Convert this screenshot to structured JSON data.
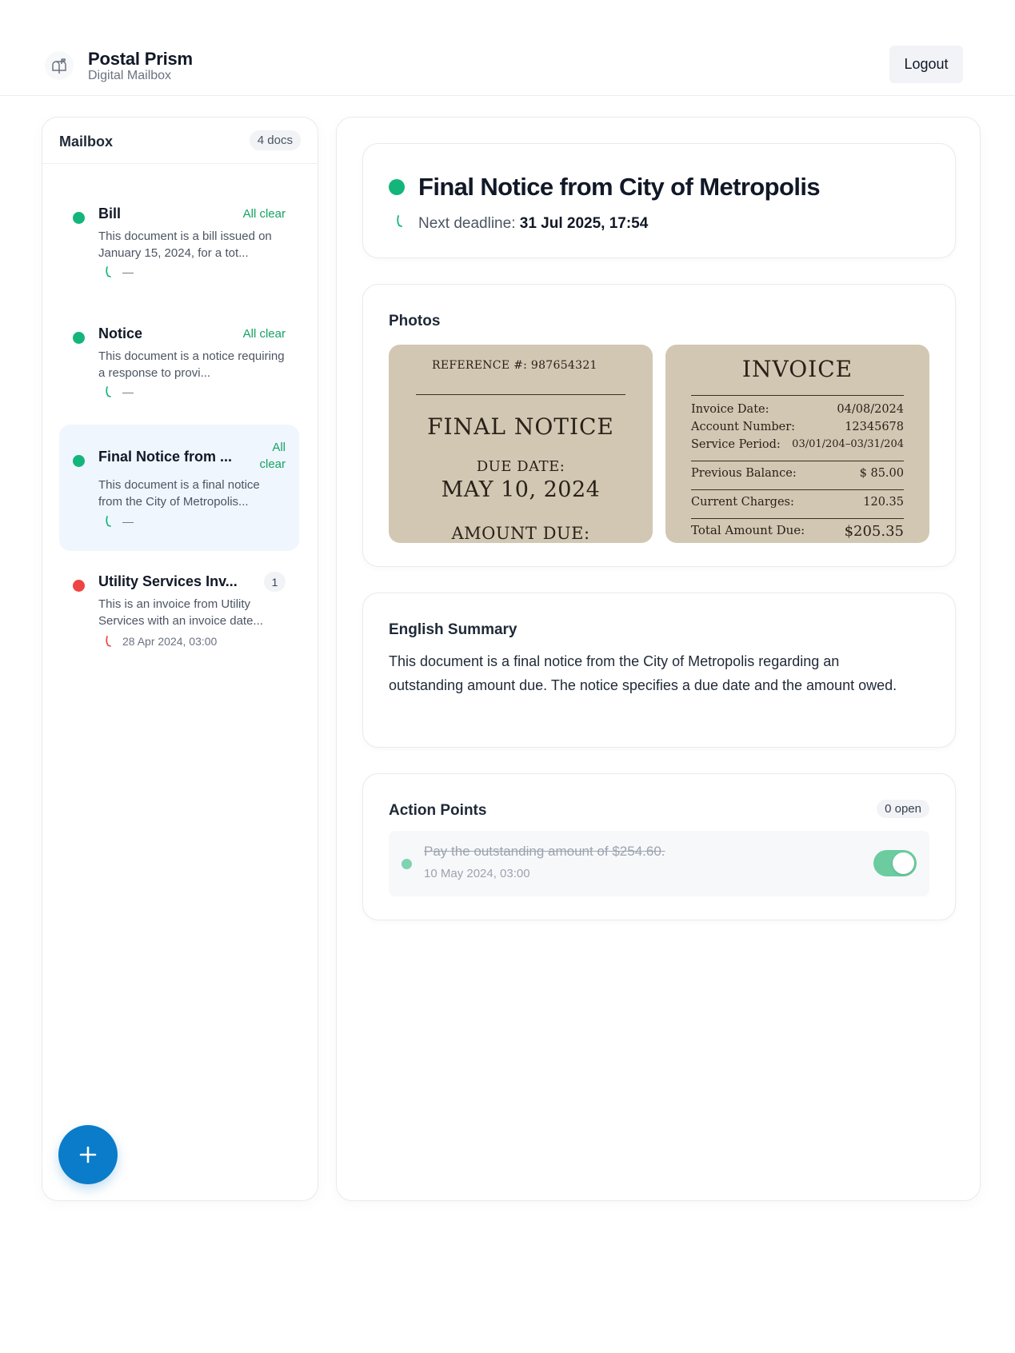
{
  "app": {
    "title": "Postal Prism",
    "subtitle": "Digital Mailbox",
    "logout_label": "Logout",
    "icon": "mailbox-icon"
  },
  "colors": {
    "accent": "#0a7cc9",
    "status_clear": "#14b57b",
    "status_alert": "#ef4444"
  },
  "sidebar": {
    "title": "Mailbox",
    "count": "4 docs",
    "items": [
      {
        "title": "Bill",
        "status": "All clear",
        "status_type": "clear",
        "desc": "This document is a bill issued on January 15, 2024, for a tot...",
        "meta": "—",
        "active": false
      },
      {
        "title": "Notice",
        "status": "All clear",
        "status_type": "clear",
        "desc": "This document is a notice requiring a response to provi...",
        "meta": "—",
        "active": false
      },
      {
        "title": "Final Notice from ...",
        "status": "All clear",
        "status_type": "clear",
        "desc": "This document is a final notice from the City of Metropolis...",
        "meta": "—",
        "active": true
      },
      {
        "title": "Utility Services Inv...",
        "badge": "1",
        "status_type": "alert",
        "desc": "This is an invoice from Utility Services with an invoice date...",
        "meta": "28 Apr 2024, 03:00",
        "active": false
      }
    ],
    "add_icon": "plus-icon"
  },
  "document": {
    "title": "Final Notice from City of Metropolis",
    "deadline_label": "Next deadline:",
    "deadline_value": "31 Jul 2025, 17:54",
    "photos_label": "Photos",
    "photo1": {
      "reference": "REFERENCE #: 987654321",
      "heading": "FINAL NOTICE",
      "due_label": "DUE DATE:",
      "due_date": "MAY 10, 2024",
      "amount_label": "AMOUNT DUE:"
    },
    "photo2": {
      "heading": "INVOICE",
      "rows": [
        {
          "label": "Invoice Date:",
          "value": "04/08/2024"
        },
        {
          "label": "Account Number:",
          "value": "12345678"
        },
        {
          "label": "Service Period:",
          "value": "03/01/204–03/31/204"
        },
        {
          "label": "Previous Balance:",
          "value": "$ 85.00"
        },
        {
          "label": "Current Charges:",
          "value": "120.35"
        },
        {
          "label": "Total Amount Due:",
          "value": "$205.35"
        }
      ]
    },
    "summary_label": "English Summary",
    "summary_text": "This document is a final notice from the City of Metropolis regarding an outstanding amount due. The notice specifies a due date and the amount owed.",
    "actions_label": "Action Points",
    "actions_open": "0 open",
    "actions": [
      {
        "text": "Pay the outstanding amount of $254.60.",
        "date": "10 May 2024, 03:00",
        "done": true
      }
    ]
  }
}
